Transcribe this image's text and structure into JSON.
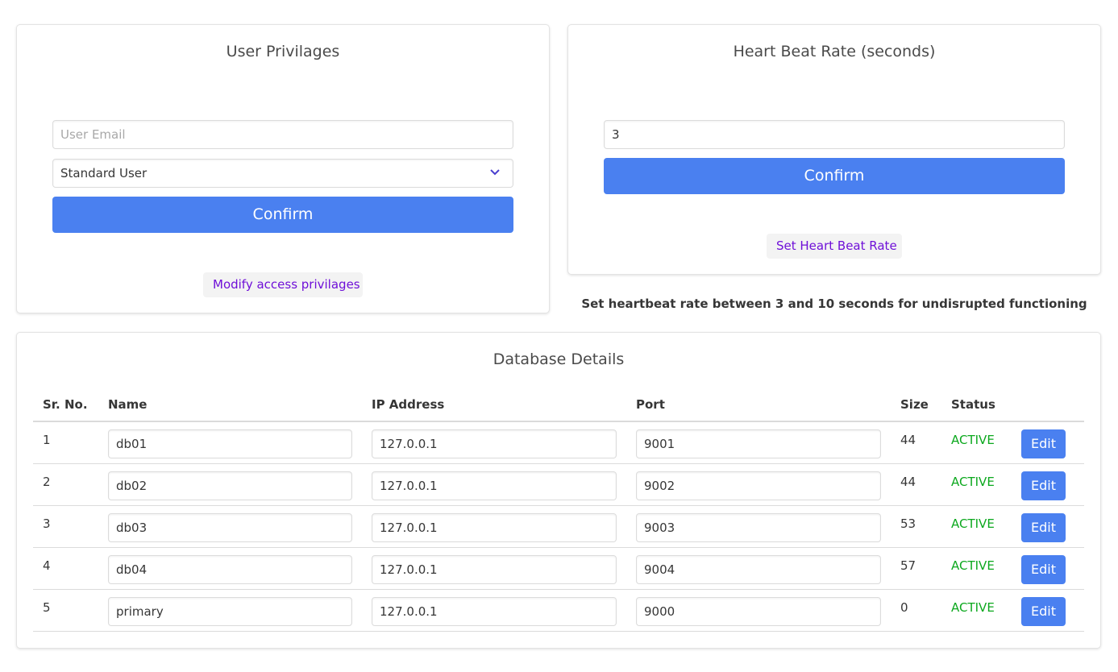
{
  "privileges": {
    "title": "User Privilages",
    "email_placeholder": "User Email",
    "role_selected": "Standard User",
    "confirm_label": "Confirm",
    "modify_label": "Modify access privilages"
  },
  "heartbeat": {
    "title": "Heart Beat Rate (seconds)",
    "rate_value": "3",
    "confirm_label": "Confirm",
    "set_label": "Set Heart Beat Rate",
    "hint": "Set heartbeat rate between 3 and 10 seconds for undisrupted functioning"
  },
  "database": {
    "title": "Database Details",
    "columns": [
      "Sr. No.",
      "Name",
      "IP Address",
      "Port",
      "Size",
      "Status"
    ],
    "edit_label": "Edit",
    "rows": [
      {
        "sr": "1",
        "name": "db01",
        "ip": "127.0.0.1",
        "port": "9001",
        "size": "44",
        "status": "ACTIVE"
      },
      {
        "sr": "2",
        "name": "db02",
        "ip": "127.0.0.1",
        "port": "9002",
        "size": "44",
        "status": "ACTIVE"
      },
      {
        "sr": "3",
        "name": "db03",
        "ip": "127.0.0.1",
        "port": "9003",
        "size": "53",
        "status": "ACTIVE"
      },
      {
        "sr": "4",
        "name": "db04",
        "ip": "127.0.0.1",
        "port": "9004",
        "size": "57",
        "status": "ACTIVE"
      },
      {
        "sr": "5",
        "name": "primary",
        "ip": "127.0.0.1",
        "port": "9000",
        "size": "0",
        "status": "ACTIVE"
      }
    ]
  },
  "colors": {
    "primary_button": "#4a80f0",
    "link_text": "#6f10d8",
    "status_active": "#0ca81e"
  }
}
